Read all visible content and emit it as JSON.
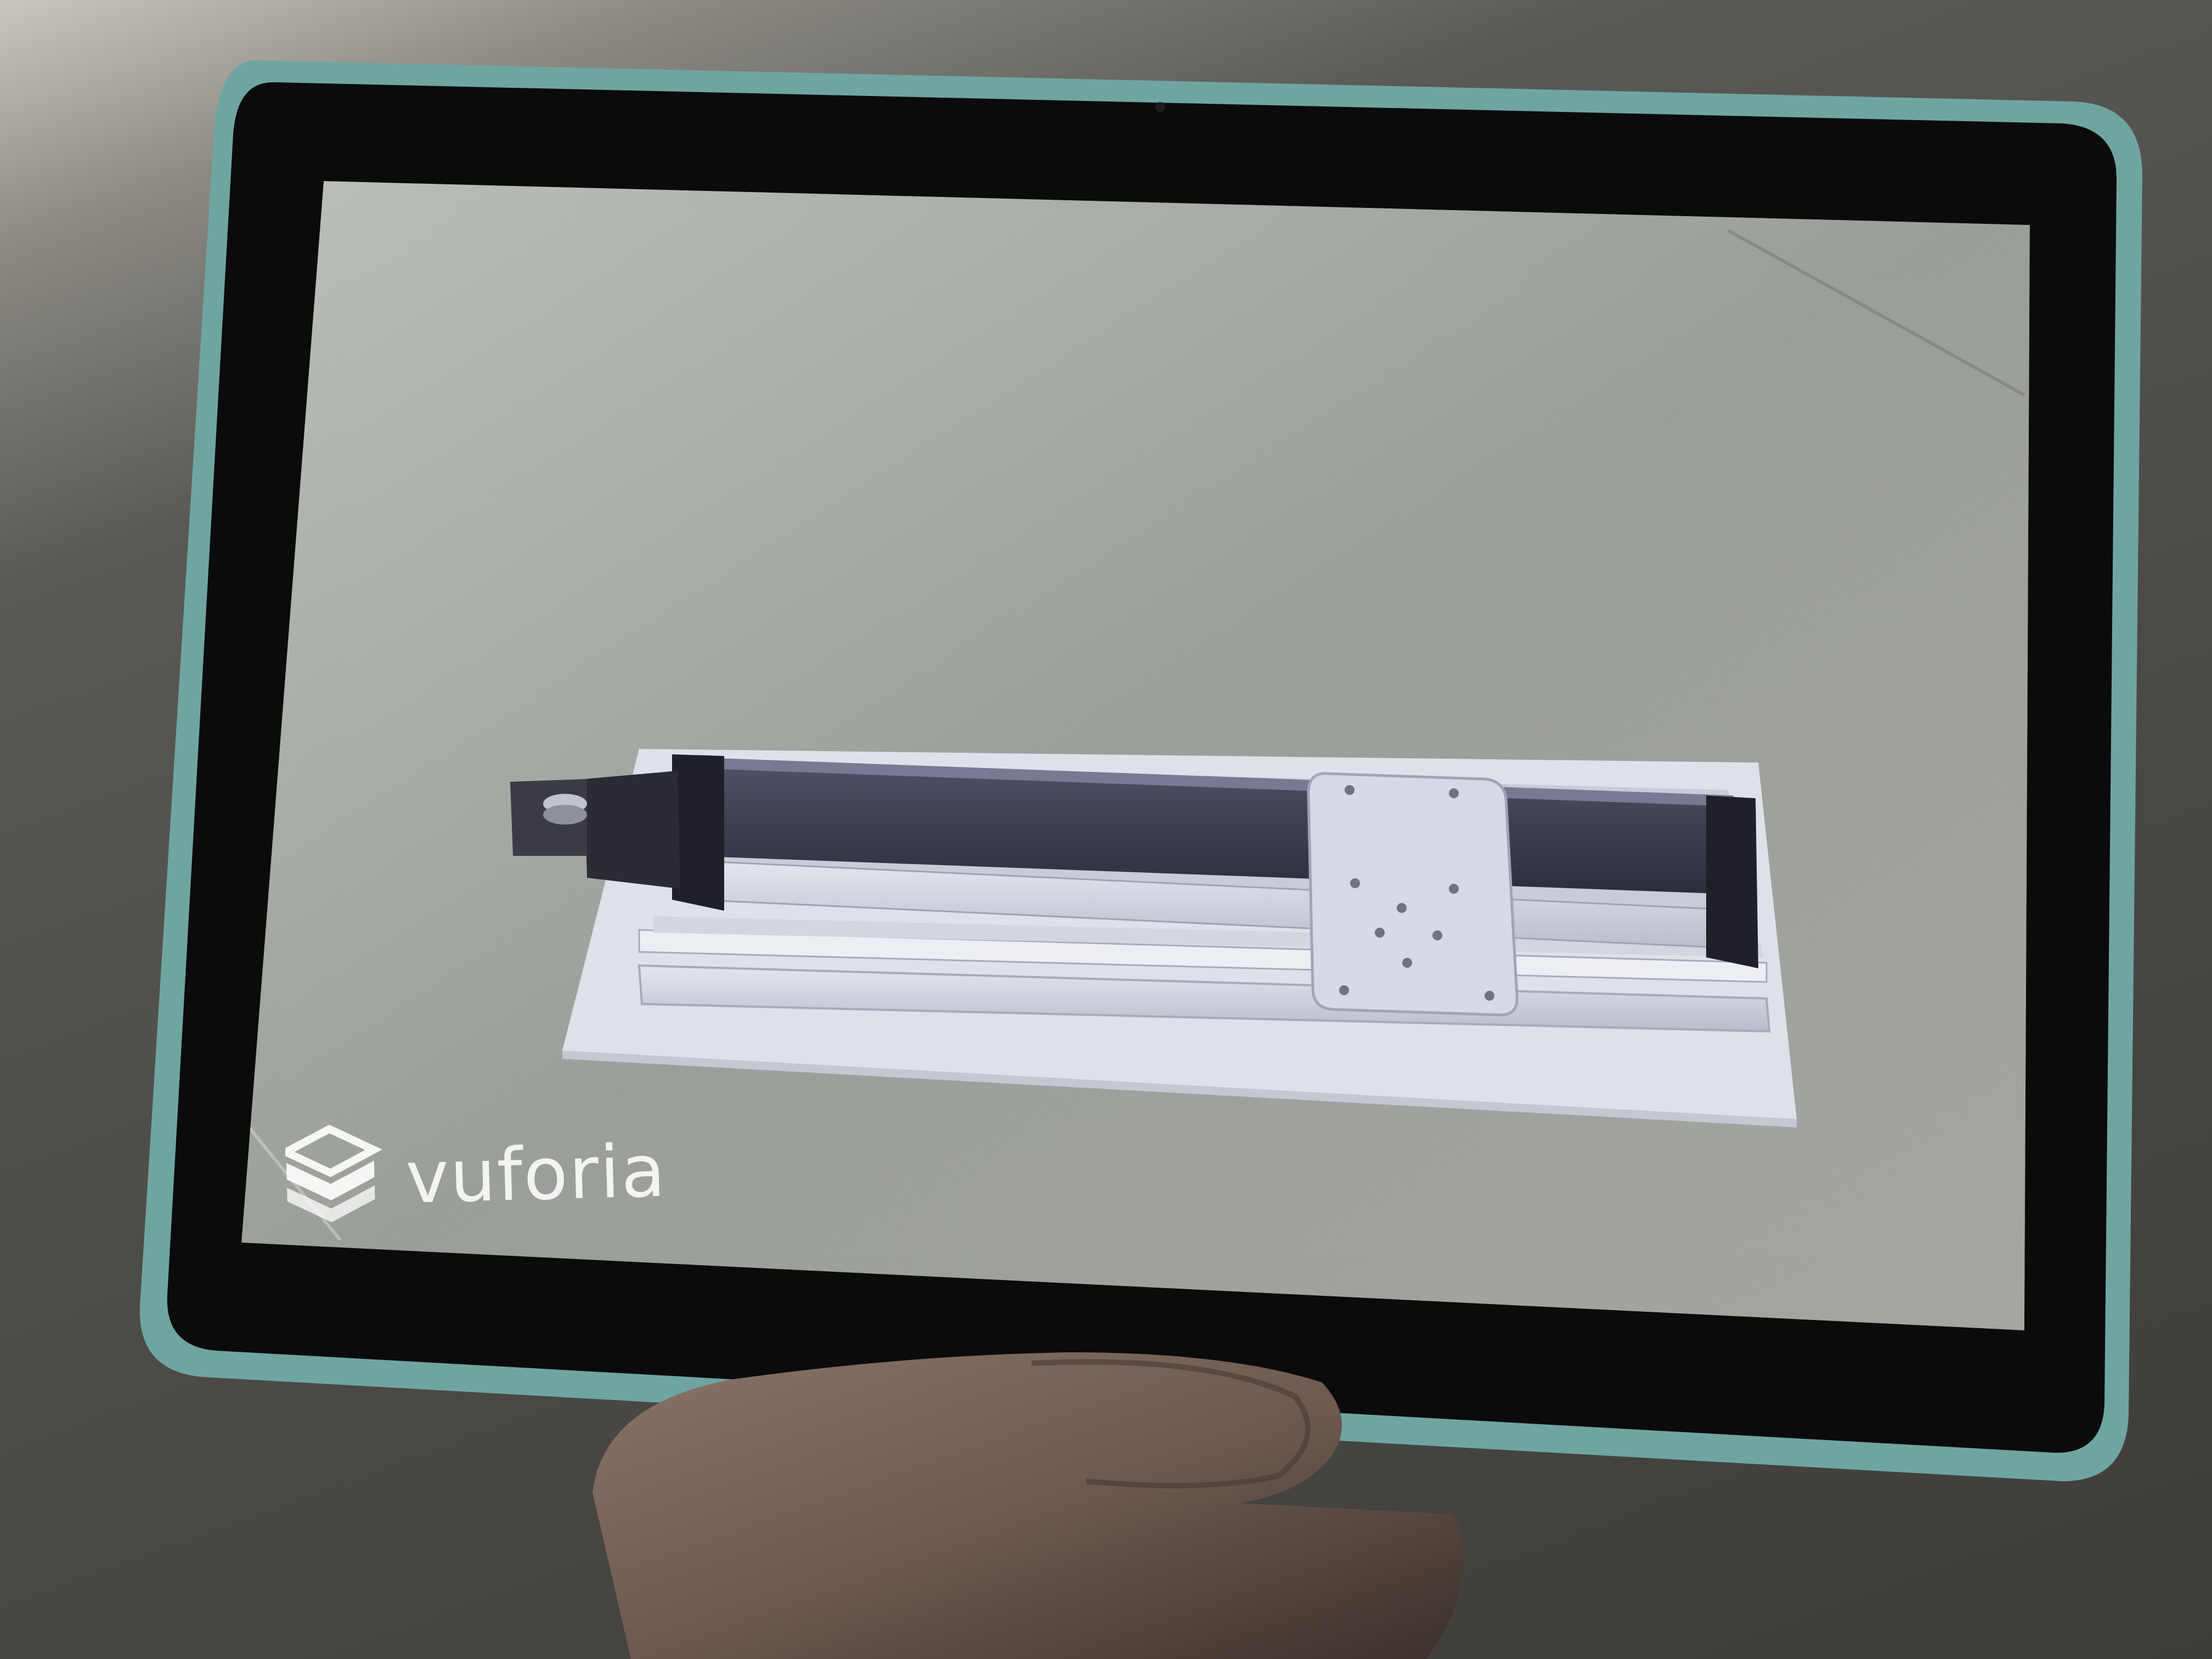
{
  "device": {
    "type": "tablet",
    "case_color": "#6fa5a1",
    "bezel_color": "#0b0b0c"
  },
  "ar_app": {
    "engine_logo_text": "vuforia",
    "engine_logo_icon": "vuforia-stacked-cube-icon",
    "camera_feed": "concrete-floor",
    "model": "linear-actuator-stage"
  }
}
